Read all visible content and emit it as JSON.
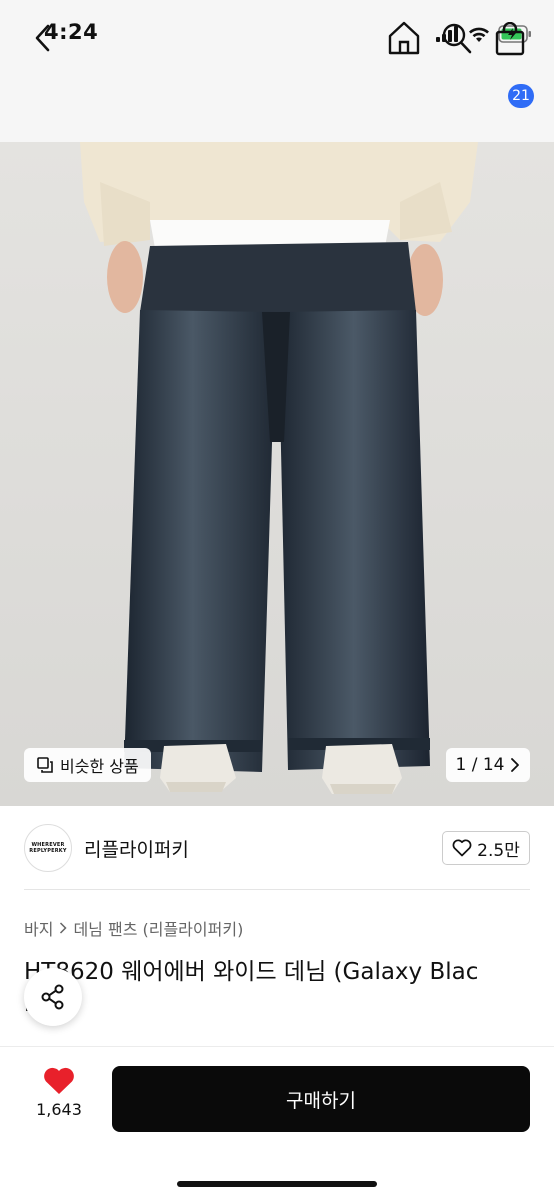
{
  "status_bar": {
    "time": "4:24"
  },
  "nav": {
    "cart_count": "21"
  },
  "hero": {
    "similar_label": "비슷한 상품",
    "page_indicator": "1 / 14"
  },
  "brand": {
    "logo_line1": "WHEREVER",
    "logo_line2": "REPLYPERKY",
    "name": "리플라이퍼키",
    "likes": "2.5만"
  },
  "breadcrumb": {
    "level1": "바지",
    "level2": "데님 팬츠 (리플라이퍼키)"
  },
  "product": {
    "title_line1": "HT8620 웨어에버 와이드 데님 (Galaxy Blac",
    "title_line2": "k"
  },
  "bottom": {
    "wish_count": "1,643",
    "buy_label": "구매하기"
  },
  "colors": {
    "accent_badge": "#2f6cf6",
    "heart": "#e8212b",
    "buy_button": "#0a0a0a"
  }
}
